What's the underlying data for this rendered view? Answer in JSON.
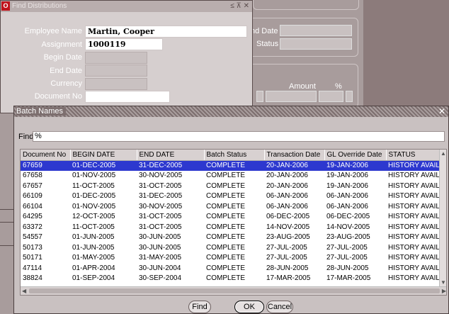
{
  "background": {
    "end_date_label": "nd Date",
    "status_label": "Status",
    "amount_header": "Amount",
    "percent_header": "%"
  },
  "find_window": {
    "title": "Find Distributions",
    "title_icons": "≤ ⊼ ✕",
    "logo": "O",
    "fields": {
      "employee_name_label": "Employee Name",
      "employee_name_value": "Martin, Cooper",
      "assignment_label": "Assignment",
      "assignment_value": "1000119",
      "begin_date_label": "Begin Date",
      "end_date_label": "End Date",
      "currency_label": "Currency",
      "document_no_label": "Document No"
    }
  },
  "batch_dialog": {
    "title": "Batch Names",
    "close": "✕",
    "find_label": "Find",
    "find_value": "%",
    "columns": [
      "Document No",
      "BEGIN DATE",
      "END DATE",
      "Batch Status",
      "Transaction Date",
      "GL Override Date",
      "STATUS"
    ],
    "rows": [
      [
        "67659",
        "01-DEC-2005",
        "31-DEC-2005",
        "COMPLETE",
        "20-JAN-2006",
        "19-JAN-2006",
        "HISTORY AVAIL"
      ],
      [
        "67658",
        "01-NOV-2005",
        "30-NOV-2005",
        "COMPLETE",
        "20-JAN-2006",
        "19-JAN-2006",
        "HISTORY AVAIL"
      ],
      [
        "67657",
        "11-OCT-2005",
        "31-OCT-2005",
        "COMPLETE",
        "20-JAN-2006",
        "19-JAN-2006",
        "HISTORY AVAIL"
      ],
      [
        "66109",
        "01-DEC-2005",
        "31-DEC-2005",
        "COMPLETE",
        "06-JAN-2006",
        "06-JAN-2006",
        "HISTORY AVAIL"
      ],
      [
        "66104",
        "01-NOV-2005",
        "30-NOV-2005",
        "COMPLETE",
        "06-JAN-2006",
        "06-JAN-2006",
        "HISTORY AVAIL"
      ],
      [
        "64295",
        "12-OCT-2005",
        "31-OCT-2005",
        "COMPLETE",
        "06-DEC-2005",
        "06-DEC-2005",
        "HISTORY AVAIL"
      ],
      [
        "63372",
        "11-OCT-2005",
        "31-OCT-2005",
        "COMPLETE",
        "14-NOV-2005",
        "14-NOV-2005",
        "HISTORY AVAIL"
      ],
      [
        "54557",
        "01-JUN-2005",
        "30-JUN-2005",
        "COMPLETE",
        "23-AUG-2005",
        "23-AUG-2005",
        "HISTORY AVAIL"
      ],
      [
        "50173",
        "01-JUN-2005",
        "30-JUN-2005",
        "COMPLETE",
        "27-JUL-2005",
        "27-JUL-2005",
        "HISTORY AVAIL"
      ],
      [
        "50171",
        "01-MAY-2005",
        "31-MAY-2005",
        "COMPLETE",
        "27-JUL-2005",
        "27-JUL-2005",
        "HISTORY AVAIL"
      ],
      [
        "47114",
        "01-APR-2004",
        "30-JUN-2004",
        "COMPLETE",
        "28-JUN-2005",
        "28-JUN-2005",
        "HISTORY AVAIL"
      ],
      [
        "38824",
        "01-SEP-2004",
        "30-SEP-2004",
        "COMPLETE",
        "17-MAR-2005",
        "17-MAR-2005",
        "HISTORY AVAIL"
      ]
    ],
    "selected_row": 0,
    "buttons": {
      "find": "Find",
      "ok": "OK",
      "cancel": "Cancel"
    },
    "colors": {
      "selection": "#2d38cf"
    }
  }
}
